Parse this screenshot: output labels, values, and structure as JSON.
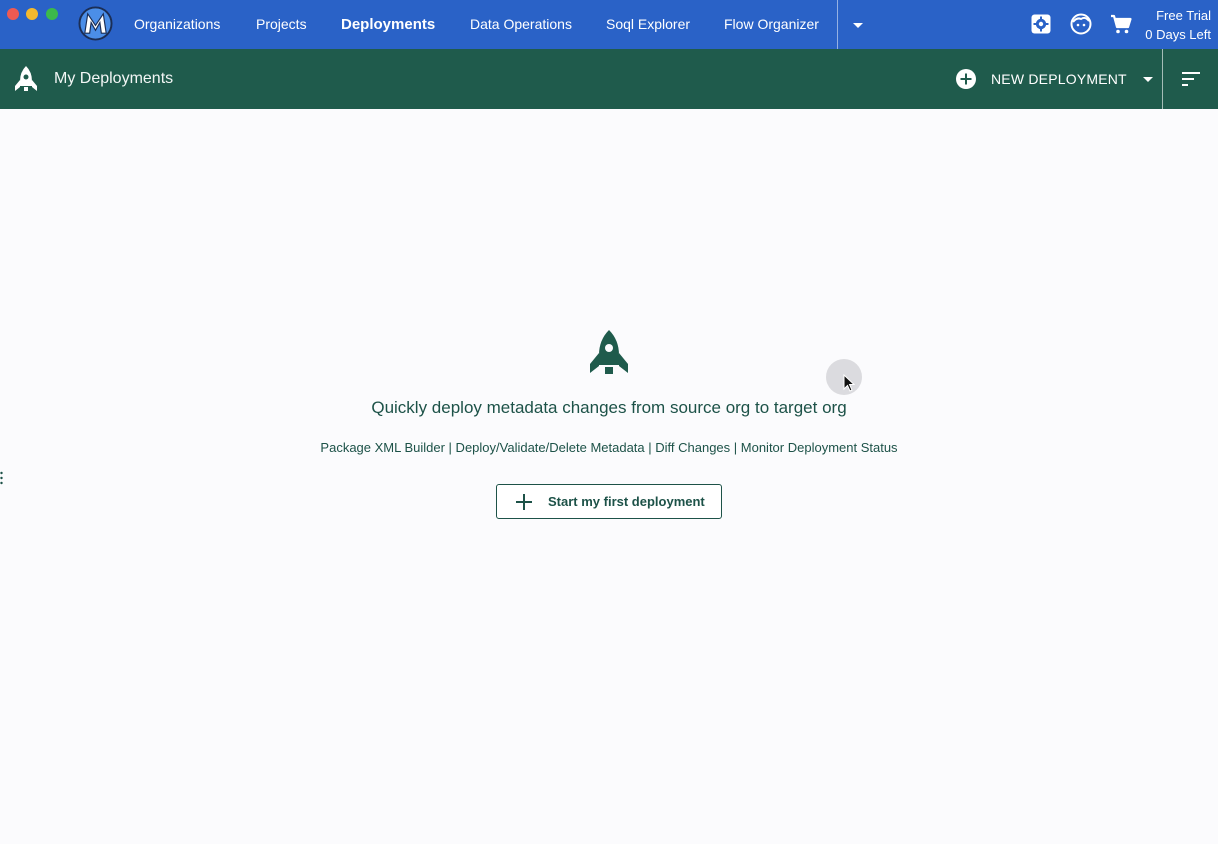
{
  "nav": {
    "items": [
      {
        "label": "Organizations",
        "active": false
      },
      {
        "label": "Projects",
        "active": false
      },
      {
        "label": "Deployments",
        "active": true
      },
      {
        "label": "Data Operations",
        "active": false
      },
      {
        "label": "Soql Explorer",
        "active": false
      },
      {
        "label": "Flow Organizer",
        "active": false
      }
    ],
    "more_icon": "caret-down-icon",
    "right_icons": [
      "settings-icon",
      "profile-icon",
      "cart-icon"
    ],
    "trial": {
      "line1": "Free Trial",
      "line2": "0 Days Left"
    }
  },
  "subheader": {
    "icon": "rocket-icon",
    "title": "My Deployments",
    "new_deployment_label": "NEW DEPLOYMENT",
    "sort_icon": "sort-icon"
  },
  "empty_state": {
    "icon": "rocket-icon",
    "heading": "Quickly deploy metadata changes from source org to target org",
    "features": "Package XML Builder | Deploy/Validate/Delete Metadata | Diff Changes | Monitor Deployment Status",
    "button_label": "Start my first deployment"
  },
  "colors": {
    "topbar": "#2a62c7",
    "subbar": "#1f5b4c",
    "accent_text": "#1d5248",
    "background": "#fbfbfd"
  }
}
